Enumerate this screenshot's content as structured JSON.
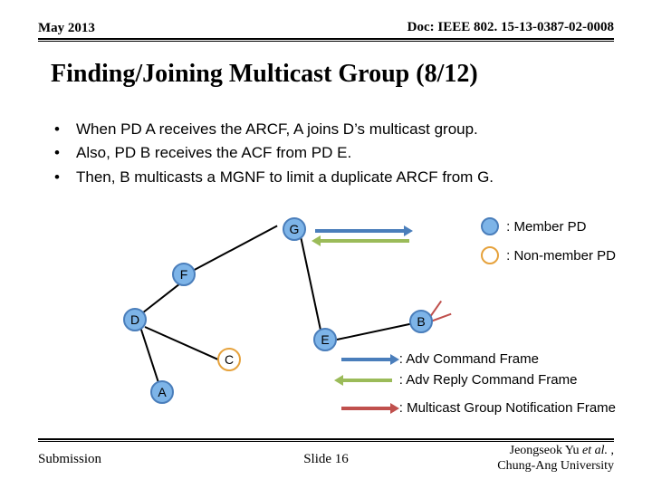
{
  "header": {
    "left": "May 2013",
    "right": "Doc: IEEE 802. 15-13-0387-02-0008"
  },
  "title": "Finding/Joining Multicast Group (8/12)",
  "bullets": [
    "When PD A receives the ARCF, A joins D’s multicast group.",
    "Also, PD B receives the ACF from PD E.",
    "Then, B multicasts a MGNF to limit a duplicate ARCF from G."
  ],
  "nodes": [
    {
      "id": "G",
      "label": "G",
      "member": true
    },
    {
      "id": "F",
      "label": "F",
      "member": true
    },
    {
      "id": "D",
      "label": "D",
      "member": true
    },
    {
      "id": "C",
      "label": "C",
      "member": false
    },
    {
      "id": "E",
      "label": "E",
      "member": true
    },
    {
      "id": "B",
      "label": "B",
      "member": true
    },
    {
      "id": "A",
      "label": "A",
      "member": true
    }
  ],
  "legend": {
    "member": ": Member PD",
    "nonmember": ": Non-member PD",
    "adv_cmd": ": Adv Command Frame",
    "adv_reply": ": Adv Reply Command Frame",
    "mgnf": ": Multicast Group Notification Frame"
  },
  "footer": {
    "left": "Submission",
    "mid": "Slide 16",
    "right_line1": "Jeongseok Yu et al. ,",
    "right_line2": "Chung-Ang University",
    "right_italic": "et al."
  }
}
